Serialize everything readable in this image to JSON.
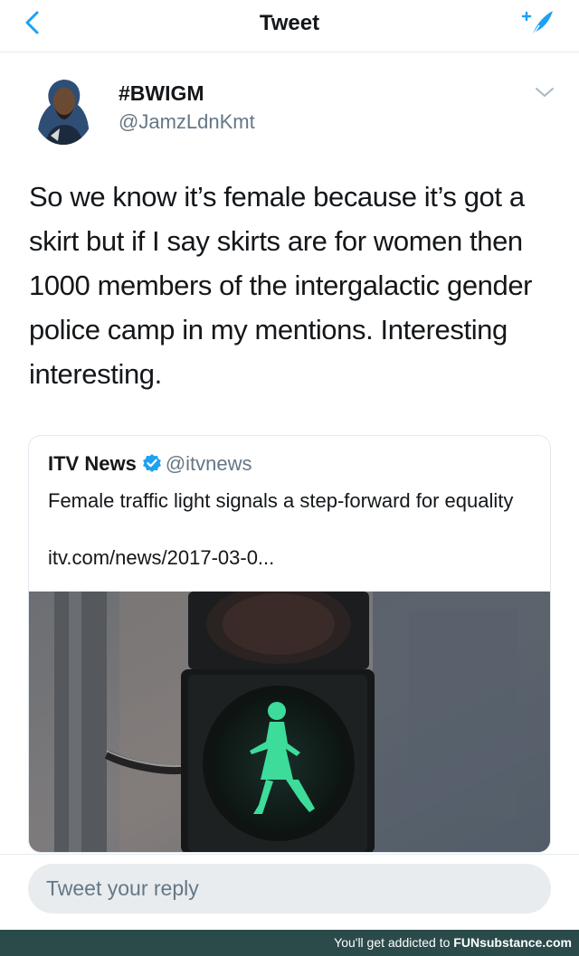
{
  "nav": {
    "title": "Tweet",
    "back_icon": "chevron-left-icon",
    "compose_icon": "compose-tweet-icon"
  },
  "tweet": {
    "display_name": "#BWIGM",
    "handle": "@JamzLdnKmt",
    "text": "So we know it’s female because it’s got a skirt but if I say skirts are for women then 1000 members of the intergalactic gender police camp in my mentions. Interesting interesting."
  },
  "quoted": {
    "name": "ITV News",
    "handle": "@itvnews",
    "headline": "Female traffic light signals a step-forward for equality",
    "link": "itv.com/news/2017-03-0..."
  },
  "reply": {
    "placeholder": "Tweet your reply"
  },
  "footer": {
    "prefix": "You'll get addicted to ",
    "brand": "FUNsubstance.com"
  },
  "colors": {
    "accent": "#1da1f2",
    "secondary_text": "#657786",
    "signal_green": "#3ddc9a",
    "footer_bg": "#2b4a4a"
  }
}
